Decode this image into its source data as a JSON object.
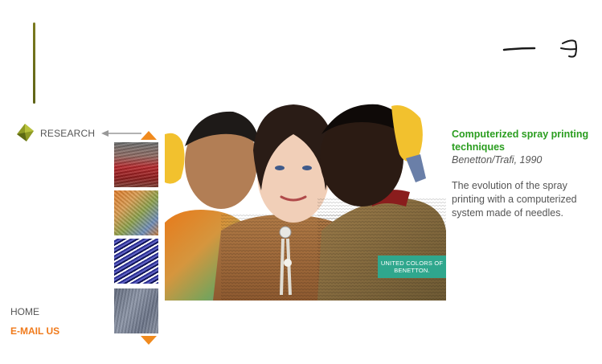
{
  "section": {
    "label": "RESEARCH",
    "icon": "diamond-icon"
  },
  "thumbnails": [
    {
      "name": "thumb-red-knit"
    },
    {
      "name": "thumb-multicolor-knit"
    },
    {
      "name": "thumb-blue-knit"
    },
    {
      "name": "thumb-grey-knit"
    }
  ],
  "photo": {
    "badge_text": "UNITED COLORS OF BENETTON."
  },
  "info": {
    "title": "Computerized spray printing techniques",
    "credit": "Benetton/Trafi, 1990",
    "description": "The evolution of the spray printing with a computerized system made of needles."
  },
  "nav": {
    "home": "HOME",
    "email": "E-MAIL US"
  },
  "colors": {
    "accent_orange": "#f07a1b",
    "title_green": "#2a9d1f",
    "badge_green": "#2fa78d",
    "text_grey": "#555555"
  }
}
